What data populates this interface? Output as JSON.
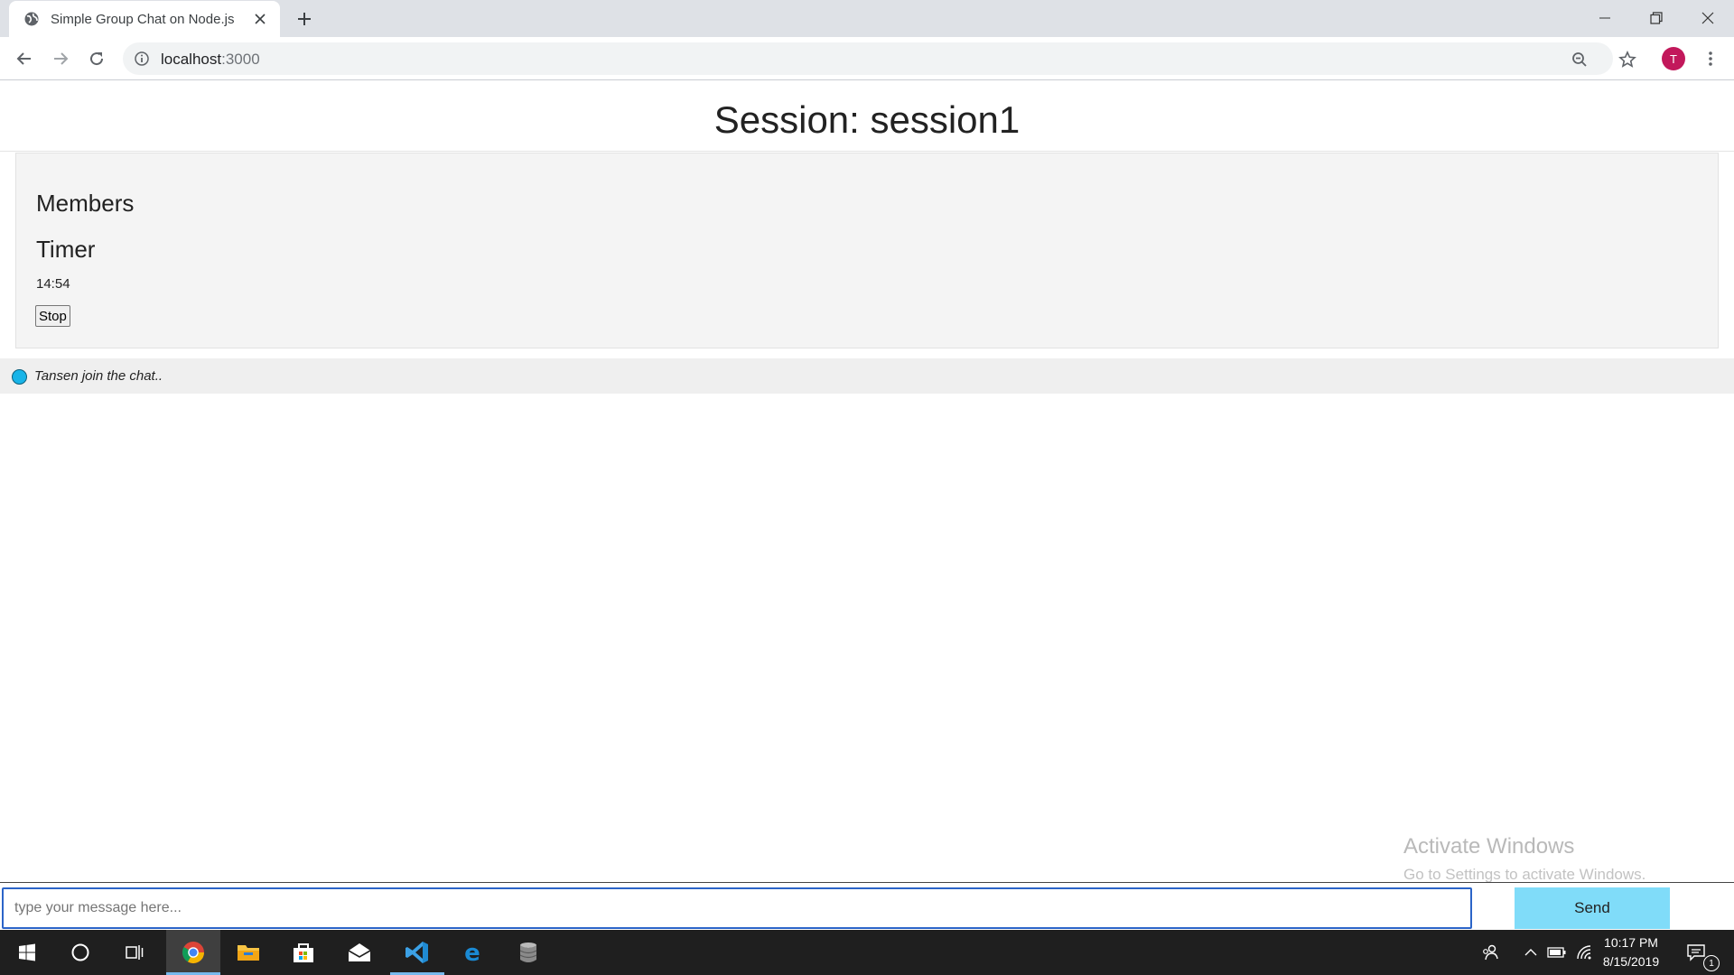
{
  "browser": {
    "tab_title": "Simple Group Chat on Node.js",
    "url_host": "localhost",
    "url_port": ":3000",
    "profile_initial": "T"
  },
  "page": {
    "title": "Session: session1",
    "members_heading": "Members",
    "timer_heading": "Timer",
    "timer_value": "14:54",
    "stop_label": "Stop",
    "notice_text": "Tansen join the chat..",
    "notice_dot_color": "#18b4e8"
  },
  "compose": {
    "placeholder": "type your message here...",
    "send_label": "Send",
    "send_color": "#80dcf9"
  },
  "watermark": {
    "title": "Activate Windows",
    "subtitle": "Go to Settings to activate Windows."
  },
  "taskbar": {
    "time": "10:17 PM",
    "date": "8/15/2019",
    "notification_count": "1",
    "apps": [
      "start-icon",
      "cortana-icon",
      "task-view-icon",
      "chrome-icon",
      "file-explorer-icon",
      "store-icon",
      "mail-icon",
      "vscode-icon",
      "edge-icon",
      "database-icon"
    ]
  }
}
